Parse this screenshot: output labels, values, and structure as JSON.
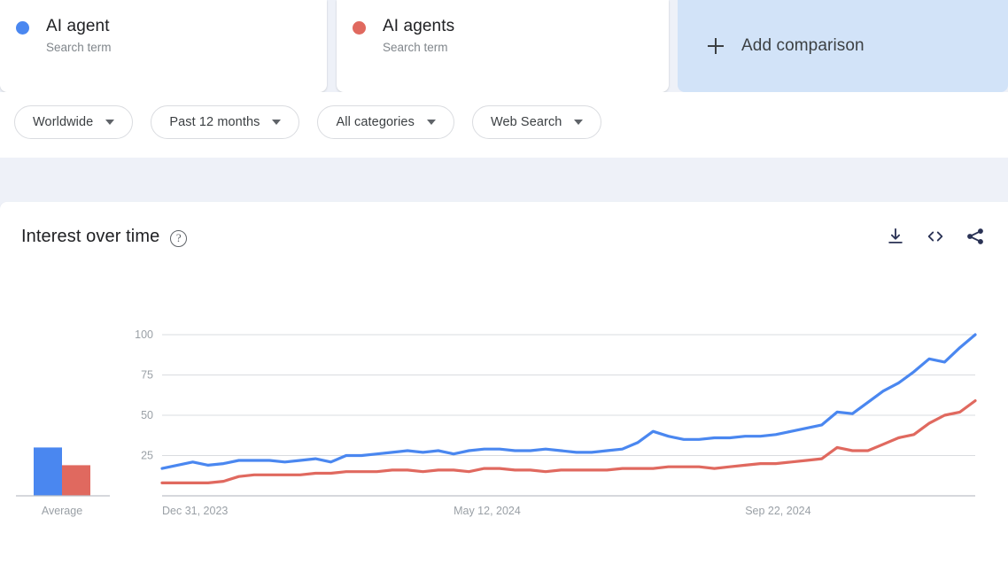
{
  "terms": [
    {
      "name": "AI agent",
      "subtitle": "Search term",
      "color": "#4a87f0",
      "dot": "legend-dot"
    },
    {
      "name": "AI agents",
      "subtitle": "Search term",
      "color": "#e0695f",
      "dot": "legend-dot"
    }
  ],
  "add_comparison": {
    "label": "Add comparison",
    "icon": "plus-icon"
  },
  "filters": [
    {
      "label": "Worldwide"
    },
    {
      "label": "Past 12 months"
    },
    {
      "label": "All categories"
    },
    {
      "label": "Web Search"
    }
  ],
  "chart_card": {
    "title": "Interest over time",
    "help_icon": "help-circle-icon",
    "actions": [
      {
        "name": "download-icon",
        "tip": "Download"
      },
      {
        "name": "embed-code-icon",
        "tip": "Embed"
      },
      {
        "name": "share-icon",
        "tip": "Share"
      }
    ]
  },
  "chart_data": {
    "type": "line",
    "title": "Interest over time",
    "xlabel": "",
    "ylabel": "",
    "ylim": [
      0,
      100
    ],
    "yticks": [
      100,
      75,
      50,
      25
    ],
    "grid": true,
    "legend_position": "top",
    "xtick_labels": [
      "Dec 31, 2023",
      "May 12, 2024",
      "Sep 22, 2024"
    ],
    "xtick_positions": [
      0,
      19,
      38
    ],
    "x_count": 53,
    "series": [
      {
        "name": "AI agent",
        "color": "#4a87f0",
        "average": 30,
        "values": [
          17,
          19,
          21,
          19,
          20,
          22,
          22,
          22,
          21,
          22,
          23,
          21,
          25,
          25,
          26,
          27,
          28,
          27,
          28,
          26,
          28,
          29,
          29,
          28,
          28,
          29,
          28,
          27,
          27,
          28,
          29,
          33,
          40,
          37,
          35,
          35,
          36,
          36,
          37,
          37,
          38,
          40,
          42,
          44,
          52,
          51,
          58,
          65,
          70,
          77,
          85,
          83,
          92,
          100
        ]
      },
      {
        "name": "AI agents",
        "color": "#e0695f",
        "average": 19,
        "values": [
          8,
          8,
          8,
          8,
          9,
          12,
          13,
          13,
          13,
          13,
          14,
          14,
          15,
          15,
          15,
          16,
          16,
          15,
          16,
          16,
          15,
          17,
          17,
          16,
          16,
          15,
          16,
          16,
          16,
          16,
          17,
          17,
          17,
          18,
          18,
          18,
          17,
          18,
          19,
          20,
          20,
          21,
          22,
          23,
          30,
          28,
          28,
          32,
          36,
          38,
          45,
          50,
          52,
          59
        ]
      }
    ],
    "average_bars": {
      "label": "Average",
      "values": [
        30,
        19
      ],
      "colors": [
        "#4a87f0",
        "#e0695f"
      ]
    }
  }
}
